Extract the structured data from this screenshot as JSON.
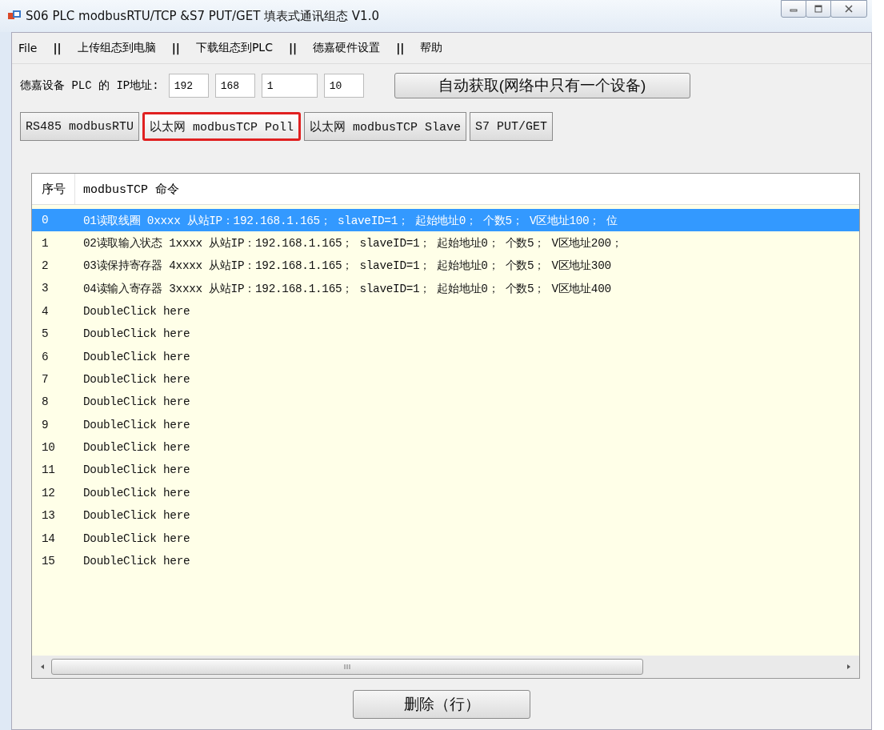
{
  "window": {
    "title": "S06 PLC modbusRTU/TCP &S7 PUT/GET 填表式通讯组态  V1.0"
  },
  "menu": [
    {
      "label": "File"
    },
    {
      "label": "||",
      "kind": "separator"
    },
    {
      "label": "上传组态到电脑"
    },
    {
      "label": "||",
      "kind": "separator"
    },
    {
      "label": "下载组态到PLC"
    },
    {
      "label": "||",
      "kind": "separator"
    },
    {
      "label": "德嘉硬件设置"
    },
    {
      "label": "||",
      "kind": "separator"
    },
    {
      "label": "帮助"
    }
  ],
  "ip": {
    "label": "德嘉设备 PLC 的 IP地址:",
    "octets": [
      "192",
      "168",
      "1",
      "10"
    ],
    "button": "自动获取(网络中只有一个设备)"
  },
  "tabs": [
    {
      "label": "RS485 modbusRTU",
      "selected": false
    },
    {
      "label": "以太网 modbusTCP Poll",
      "selected": true
    },
    {
      "label": "以太网 modbusTCP Slave",
      "selected": false
    },
    {
      "label": "S7 PUT/GET",
      "selected": false
    }
  ],
  "table": {
    "columns": [
      "序号",
      "modbusTCP 命令"
    ],
    "rows": [
      {
        "index": "0",
        "command": "01读取线圈 0xxxx 从站IP：192.168.1.165； slaveID=1； 起始地址0； 个数5； V区地址100； 位",
        "selected": true
      },
      {
        "index": "1",
        "command": "02读取输入状态 1xxxx 从站IP：192.168.1.165； slaveID=1； 起始地址0； 个数5； V区地址200；",
        "selected": false
      },
      {
        "index": "2",
        "command": "03读保持寄存器 4xxxx 从站IP：192.168.1.165； slaveID=1； 起始地址0； 个数5； V区地址300",
        "selected": false
      },
      {
        "index": "3",
        "command": "04读输入寄存器 3xxxx 从站IP：192.168.1.165； slaveID=1； 起始地址0； 个数5； V区地址400",
        "selected": false
      },
      {
        "index": "4",
        "command": "DoubleClick here",
        "selected": false
      },
      {
        "index": "5",
        "command": "DoubleClick here",
        "selected": false
      },
      {
        "index": "6",
        "command": "DoubleClick here",
        "selected": false
      },
      {
        "index": "7",
        "command": "DoubleClick here",
        "selected": false
      },
      {
        "index": "8",
        "command": "DoubleClick here",
        "selected": false
      },
      {
        "index": "9",
        "command": "DoubleClick here",
        "selected": false
      },
      {
        "index": "10",
        "command": "DoubleClick here",
        "selected": false
      },
      {
        "index": "11",
        "command": "DoubleClick here",
        "selected": false
      },
      {
        "index": "12",
        "command": "DoubleClick here",
        "selected": false
      },
      {
        "index": "13",
        "command": "DoubleClick here",
        "selected": false
      },
      {
        "index": "14",
        "command": "DoubleClick here",
        "selected": false
      },
      {
        "index": "15",
        "command": "DoubleClick here",
        "selected": false
      }
    ]
  },
  "delete_button": "删除（行）"
}
